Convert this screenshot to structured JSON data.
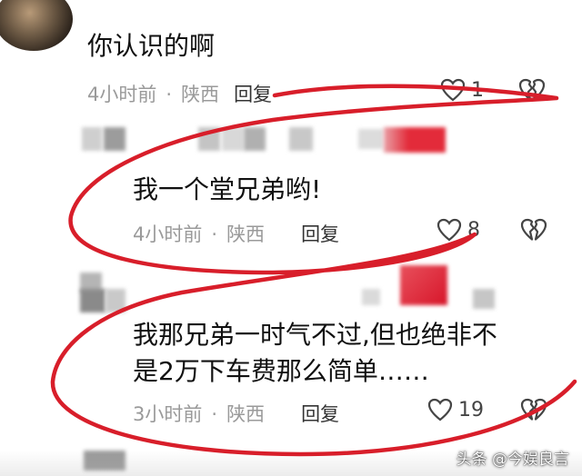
{
  "comments": [
    {
      "text": "你认识的啊",
      "time": "4小时前",
      "location": "陕西",
      "reply_label": "回复",
      "likes": "1"
    },
    {
      "text": "我一个堂兄弟哟!",
      "time": "4小时前",
      "location": "陕西",
      "reply_label": "回复",
      "likes": "8"
    },
    {
      "text_line1": "我那兄弟一时气不过,但也绝非不",
      "text_line2": "是2万下车费那么简单……",
      "time": "3小时前",
      "location": "陕西",
      "reply_label": "回复",
      "likes": "19"
    }
  ],
  "separator": "·",
  "watermark": "头条 @今娱良言",
  "icons": {
    "like": "heart-outline-icon",
    "dislike": "broken-heart-icon"
  },
  "colors": {
    "annotation": "#d81e2a",
    "muted_text": "#9a9a9a"
  }
}
